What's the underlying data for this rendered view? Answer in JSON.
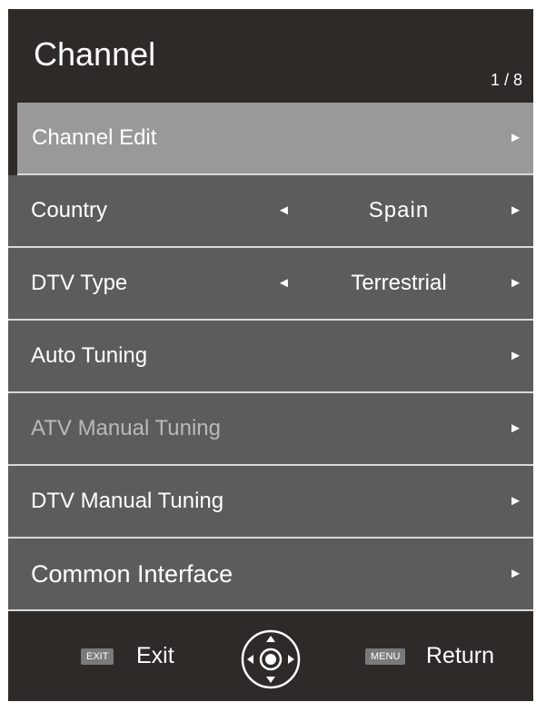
{
  "header": {
    "title": "Channel",
    "page_indicator": "1 / 8"
  },
  "menu": {
    "items": [
      {
        "label": "Channel Edit",
        "value": ""
      },
      {
        "label": "Country",
        "value": "Spain"
      },
      {
        "label": "DTV Type",
        "value": "Terrestrial"
      },
      {
        "label": "Auto Tuning",
        "value": ""
      },
      {
        "label": "ATV Manual Tuning",
        "value": ""
      },
      {
        "label": "DTV Manual Tuning",
        "value": ""
      },
      {
        "label": "Common Interface",
        "value": ""
      }
    ],
    "selected_index": 0,
    "disabled_index": 4
  },
  "footer": {
    "exit_key": "EXIT",
    "exit_label": "Exit",
    "menu_key": "MENU",
    "return_label": "Return"
  },
  "icons": {
    "right_arrow": "arrow-right-icon",
    "left_arrow": "arrow-left-icon",
    "navigation": "dpad-navigation-icon"
  },
  "colors": {
    "background": "#2e2a28",
    "row": "#5c5c5c",
    "selected_row": "#999999",
    "disabled_text": "#b9b9b9",
    "separator": "#d9d9d9"
  }
}
